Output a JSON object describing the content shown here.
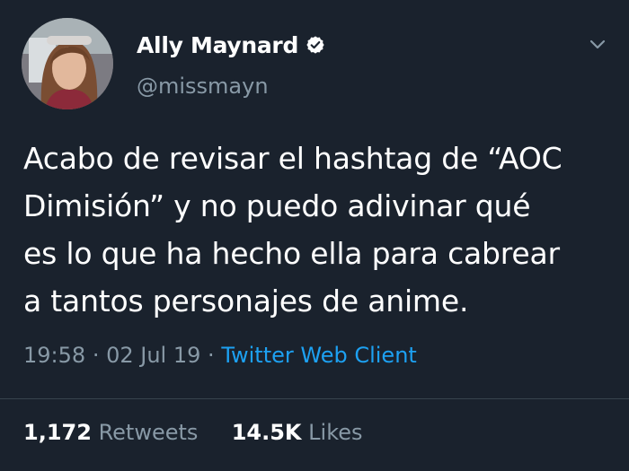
{
  "profile": {
    "display_name": "Ally Maynard",
    "handle": "@missmayn",
    "verified": true
  },
  "tweet": {
    "lines": [
      "Acabo de revisar el hashtag de “AOC",
      "Dimisión” y no puedo adivinar qué",
      "es lo que ha hecho ella para cabrear",
      "a tantos personajes de anime."
    ]
  },
  "meta": {
    "time": "19:58",
    "separator": "·",
    "date": "02 Jul 19",
    "client": "Twitter Web Client"
  },
  "stats": {
    "retweets_count": "1,172",
    "retweets_label": "Retweets",
    "likes_count": "14.5K",
    "likes_label": "Likes"
  },
  "colors": {
    "background": "#1a222d",
    "text_primary": "#ffffff",
    "text_secondary": "#8899a6",
    "link": "#1da1f2"
  },
  "icons": {
    "verified": "verified-badge-icon",
    "menu": "chevron-down-icon"
  }
}
